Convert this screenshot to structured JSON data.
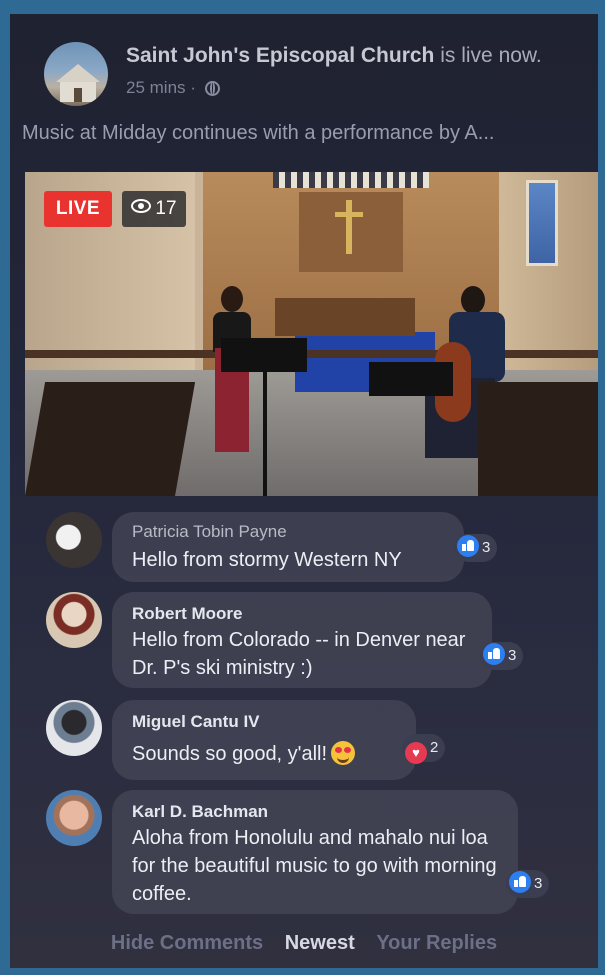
{
  "post": {
    "page_name": "Saint John's Episcopal Church",
    "live_text": " is live now.",
    "time": "25 mins",
    "separator": " · ",
    "description": "Music at Midday continues with a performance by A..."
  },
  "video": {
    "live_label": "LIVE",
    "viewer_count": "17"
  },
  "comments": [
    {
      "name": "Patricia Tobin Payne",
      "text": "Hello from stormy Western NY",
      "reaction": "like",
      "count": "3"
    },
    {
      "name": "Robert Moore",
      "text": "Hello from Colorado -- in Denver near Dr. P's ski ministry :)",
      "reaction": "like",
      "count": "3"
    },
    {
      "name": "Miguel Cantu IV",
      "text": "Sounds so good, y'all!",
      "reaction": "love",
      "count": "2"
    },
    {
      "name": "Karl D. Bachman",
      "text": "Aloha from Honolulu and mahalo nui loa for the beautiful music to go with morning coffee.",
      "reaction": "like",
      "count": "3"
    }
  ],
  "footer": {
    "hide": "Hide Comments",
    "newest": "Newest",
    "replies": "Your Replies"
  },
  "colors": {
    "live_badge": "#e8332f",
    "like": "#2d7ff0",
    "love": "#e63a52",
    "background": "#2e6a93"
  }
}
